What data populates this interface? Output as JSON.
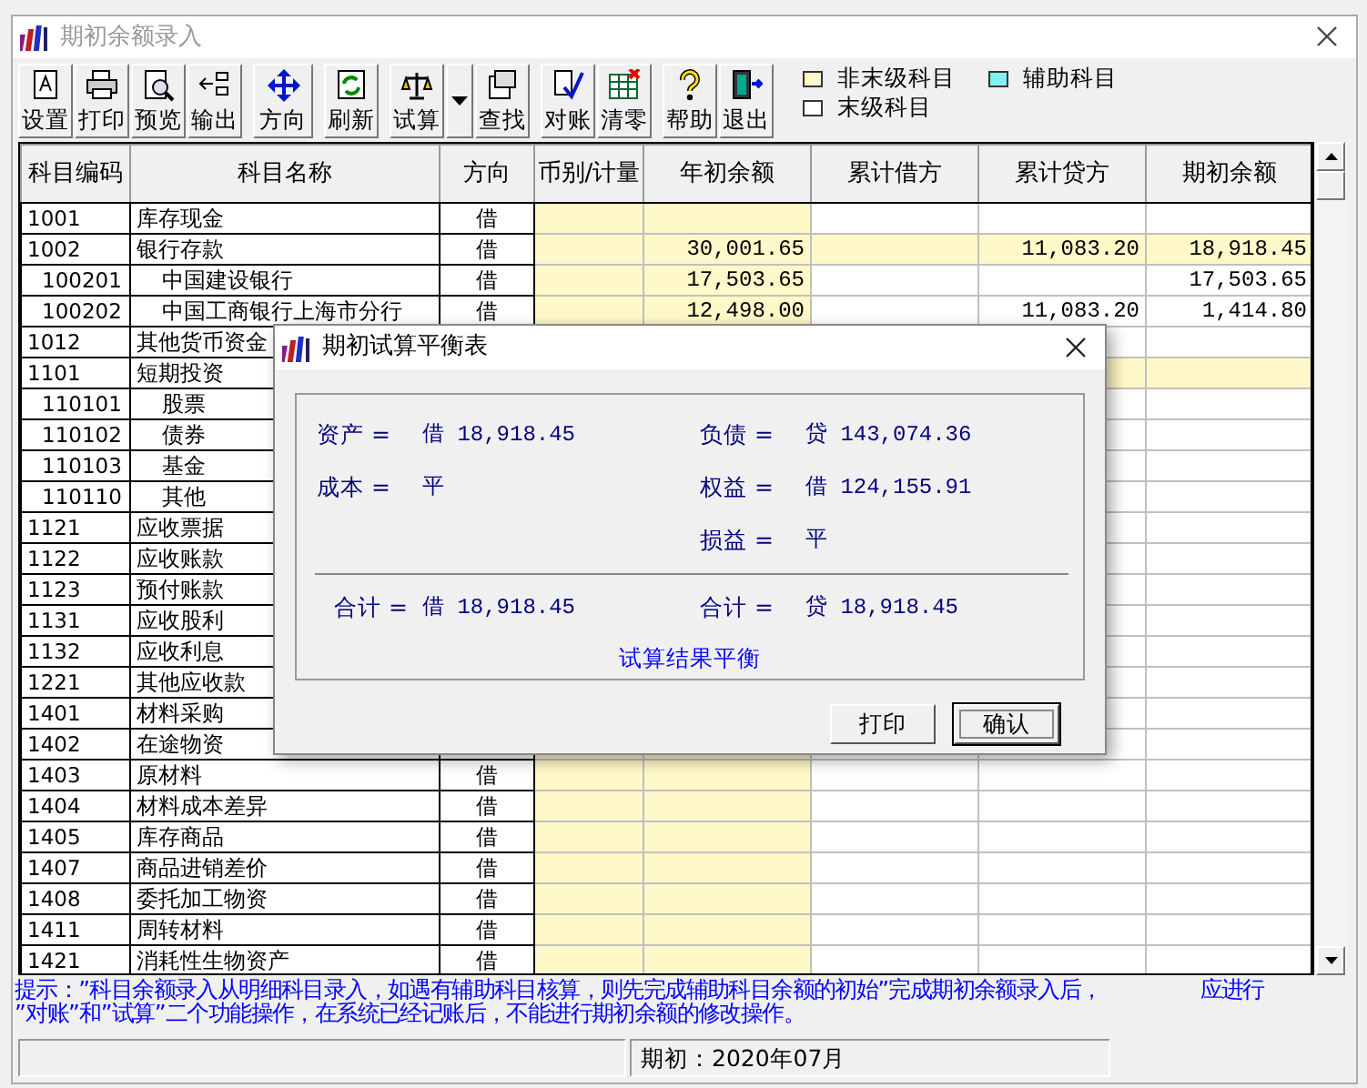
{
  "window": {
    "title": "期初余额录入"
  },
  "toolbar": {
    "groups": [
      [
        {
          "label": "设置"
        },
        {
          "label": "打印"
        },
        {
          "label": "预览"
        },
        {
          "label": "输出"
        }
      ],
      [
        {
          "label": "方向"
        }
      ],
      [
        {
          "label": "刷新"
        }
      ],
      [
        {
          "label": "试算",
          "dropdown": true
        },
        {
          "label": "查找"
        }
      ],
      [
        {
          "label": "对账"
        },
        {
          "label": "清零"
        }
      ],
      [
        {
          "label": "帮助"
        },
        {
          "label": "退出"
        }
      ]
    ]
  },
  "legend": [
    {
      "label": "非末级科目",
      "color": "#fff8c8"
    },
    {
      "label": "辅助科目",
      "color": "#80f0f0"
    },
    {
      "label": "末级科目",
      "color": "#ffffff"
    }
  ],
  "table": {
    "columns": [
      "科目编码",
      "科目名称",
      "方向",
      "币别/计量",
      "年初余额",
      "累计借方",
      "累计贷方",
      "期初余额"
    ],
    "rows": [
      {
        "code": "1001",
        "name": "库存现金",
        "direction": "借",
        "leaf": true
      },
      {
        "code": "1002",
        "name": "银行存款",
        "direction": "借",
        "leaf": false,
        "opening": "30,001.65",
        "credit": "11,083.20",
        "balance": "18,918.45",
        "children": [
          {
            "code": "100201",
            "name": "中国建设银行",
            "direction": "借",
            "leaf": true,
            "opening": "17,503.65",
            "balance": "17,503.65"
          },
          {
            "code": "100202",
            "name": "中国工商银行上海市分行",
            "direction": "借",
            "leaf": true,
            "opening": "12,498.00",
            "credit": "11,083.20",
            "balance": "1,414.80"
          }
        ]
      },
      {
        "code": "1012",
        "name": "其他货币资金",
        "leaf": true
      },
      {
        "code": "1101",
        "name": "短期投资",
        "leaf": false,
        "children": [
          {
            "code": "110101",
            "name": "股票",
            "leaf": true
          },
          {
            "code": "110102",
            "name": "债券",
            "leaf": true
          },
          {
            "code": "110103",
            "name": "基金",
            "leaf": true
          },
          {
            "code": "110110",
            "name": "其他",
            "leaf": true
          }
        ]
      },
      {
        "code": "1121",
        "name": "应收票据",
        "leaf": true
      },
      {
        "code": "1122",
        "name": "应收账款",
        "leaf": true
      },
      {
        "code": "1123",
        "name": "预付账款",
        "leaf": true
      },
      {
        "code": "1131",
        "name": "应收股利",
        "leaf": true
      },
      {
        "code": "1132",
        "name": "应收利息",
        "leaf": true
      },
      {
        "code": "1221",
        "name": "其他应收款",
        "leaf": true
      },
      {
        "code": "1401",
        "name": "材料采购",
        "leaf": true
      },
      {
        "code": "1402",
        "name": "在途物资",
        "leaf": true
      },
      {
        "code": "1403",
        "name": "原材料",
        "direction": "借",
        "leaf": true
      },
      {
        "code": "1404",
        "name": "材料成本差异",
        "direction": "借",
        "leaf": true
      },
      {
        "code": "1405",
        "name": "库存商品",
        "direction": "借",
        "leaf": true
      },
      {
        "code": "1407",
        "name": "商品进销差价",
        "direction": "借",
        "leaf": true
      },
      {
        "code": "1408",
        "name": "委托加工物资",
        "direction": "借",
        "leaf": true
      },
      {
        "code": "1411",
        "name": "周转材料",
        "direction": "借",
        "leaf": true
      },
      {
        "code": "1421",
        "name": "消耗性生物资产",
        "direction": "借",
        "leaf": true
      }
    ]
  },
  "hint": {
    "lines": [
      {
        "text": "提示：”科目余额录入从明细科目录入，如遇有辅助科目核算，则先完成辅助科目余额的初始”完成期初余额录入后，",
        "aside": "应进行"
      },
      {
        "text": "”对账”和”试算”二个功能操作，在系统已经记账后，不能进行期初余额的修改操作。"
      }
    ]
  },
  "status_bar": [
    "期初：2020年07月"
  ],
  "dialog": {
    "title": "期初试算平衡表",
    "rows": [
      {
        "left": {
          "label": "资产 =",
          "value": "借 18,918.45"
        },
        "right": {
          "label": "负债 =",
          "value": "贷 143,074.36"
        }
      },
      {
        "left": {
          "label": "成本 =",
          "value": "平"
        },
        "right": {
          "label": "权益 =",
          "value": "借 124,155.91"
        }
      },
      {
        "right": {
          "label": "损益 =",
          "value": "平"
        }
      }
    ],
    "totals": {
      "left": {
        "label": "合计 =",
        "value": "借 18,918.45"
      },
      "right": {
        "label": "合计 =",
        "value": "贷 18,918.45"
      }
    },
    "result": "试算结果平衡",
    "buttons": [
      {
        "label": "打印",
        "focused": false
      },
      {
        "label": "确认",
        "focused": true
      }
    ]
  }
}
